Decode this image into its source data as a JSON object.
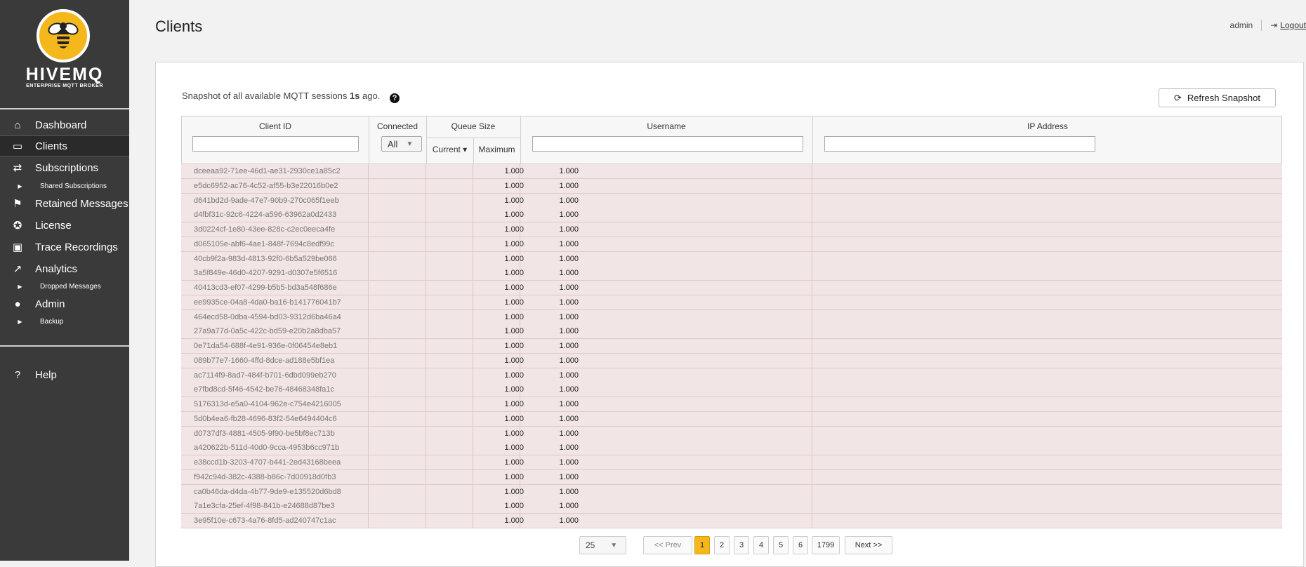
{
  "brand": {
    "name": "HIVEMQ",
    "tagline": "ENTERPRISE MQTT BROKER"
  },
  "sidebar": {
    "items": [
      {
        "label": "Dashboard",
        "icon": "home-icon"
      },
      {
        "label": "Clients",
        "icon": "devices-icon"
      },
      {
        "label": "Subscriptions",
        "icon": "shuffle-icon"
      },
      {
        "label": "Retained Messages",
        "icon": "flag-icon"
      },
      {
        "label": "License",
        "icon": "award-icon"
      },
      {
        "label": "Trace Recordings",
        "icon": "trace-icon"
      },
      {
        "label": "Analytics",
        "icon": "chart-icon"
      },
      {
        "label": "Admin",
        "icon": "user-icon"
      },
      {
        "label": "Help",
        "icon": "help-icon"
      }
    ],
    "subitems": {
      "shared_subscriptions": "Shared Subscriptions",
      "dropped_messages": "Dropped Messages",
      "backup": "Backup"
    }
  },
  "header": {
    "title": "Clients",
    "user": "admin",
    "logout": "Logout"
  },
  "snapshot": {
    "prefix": "Snapshot of all available MQTT sessions",
    "age": "1s",
    "suffix": "ago.",
    "refresh_label": "Refresh Snapshot"
  },
  "table": {
    "headers": {
      "client_id": "Client ID",
      "connected": "Connected",
      "queue_size": "Queue Size",
      "current": "Current ▾",
      "maximum": "Maximum",
      "username": "Username",
      "ip_address": "IP Address"
    },
    "connected_filter": "All",
    "rows": [
      {
        "id": "dceeaa92-71ee-46d1-ae31-2930ce1a85c2",
        "current": "1.000",
        "max": "1.000"
      },
      {
        "id": "e5dc6952-ac76-4c52-af55-b3e22016b0e2",
        "current": "1.000",
        "max": "1.000"
      },
      {
        "id": "d641bd2d-9ade-47e7-90b9-270c065f1eeb",
        "current": "1.000",
        "max": "1.000"
      },
      {
        "id": "d4fbf31c-92c6-4224-a596-63962a0d2433",
        "current": "1.000",
        "max": "1.000"
      },
      {
        "id": "3d0224cf-1e80-43ee-828c-c2ec0eeca4fe",
        "current": "1.000",
        "max": "1.000"
      },
      {
        "id": "d065105e-abf6-4ae1-848f-7694c8edf99c",
        "current": "1.000",
        "max": "1.000"
      },
      {
        "id": "40cb9f2a-983d-4813-92f0-6b5a529be066",
        "current": "1.000",
        "max": "1.000"
      },
      {
        "id": "3a5f849e-46d0-4207-9291-d0307e5f6516",
        "current": "1.000",
        "max": "1.000"
      },
      {
        "id": "40413cd3-ef07-4299-b5b5-bd3a548f686e",
        "current": "1.000",
        "max": "1.000"
      },
      {
        "id": "ee9935ce-04a8-4da0-ba16-b141776041b7",
        "current": "1.000",
        "max": "1.000"
      },
      {
        "id": "464ecd58-0dba-4594-bd03-9312d6ba46a4",
        "current": "1.000",
        "max": "1.000"
      },
      {
        "id": "27a9a77d-0a5c-422c-bd59-e20b2a8dba57",
        "current": "1.000",
        "max": "1.000"
      },
      {
        "id": "0e71da54-688f-4e91-936e-0f06454e8eb1",
        "current": "1.000",
        "max": "1.000"
      },
      {
        "id": "089b77e7-1660-4ffd-8dce-ad188e5bf1ea",
        "current": "1.000",
        "max": "1.000"
      },
      {
        "id": "ac7114f9-8ad7-484f-b701-6dbd099eb270",
        "current": "1.000",
        "max": "1.000"
      },
      {
        "id": "e7fbd8cd-5f46-4542-be76-48468348fa1c",
        "current": "1.000",
        "max": "1.000"
      },
      {
        "id": "5176313d-e5a0-4104-962e-c754e4216005",
        "current": "1.000",
        "max": "1.000"
      },
      {
        "id": "5d0b4ea6-fb28-4696-83f2-54e6494404c6",
        "current": "1.000",
        "max": "1.000"
      },
      {
        "id": "d0737df3-4881-4505-9f90-be5bf8ec713b",
        "current": "1.000",
        "max": "1.000"
      },
      {
        "id": "a420622b-511d-40d0-9cca-4953b6cc971b",
        "current": "1.000",
        "max": "1.000"
      },
      {
        "id": "e38ccd1b-3203-4707-b441-2ed43168beea",
        "current": "1.000",
        "max": "1.000"
      },
      {
        "id": "f942c94d-382c-4388-b86c-7d00918d0fb3",
        "current": "1.000",
        "max": "1.000"
      },
      {
        "id": "ca0b46da-d4da-4b77-9de9-e135520d6bd8",
        "current": "1.000",
        "max": "1.000"
      },
      {
        "id": "7a1e3cfa-25ef-4f98-841b-e24688d87be3",
        "current": "1.000",
        "max": "1.000"
      },
      {
        "id": "3e95f10e-c673-4a76-8fd5-ad240747c1ac",
        "current": "1.000",
        "max": "1.000"
      }
    ]
  },
  "pagination": {
    "page_size": "25",
    "prev": "<< Prev",
    "pages": [
      "1",
      "2",
      "3",
      "4",
      "5",
      "6",
      "1799"
    ],
    "active_page": "1",
    "next": "Next >>"
  },
  "colors": {
    "sidebar_bg": "#3a3a3a",
    "accent": "#f5b81c",
    "row_bg": "#f2e5e5"
  }
}
